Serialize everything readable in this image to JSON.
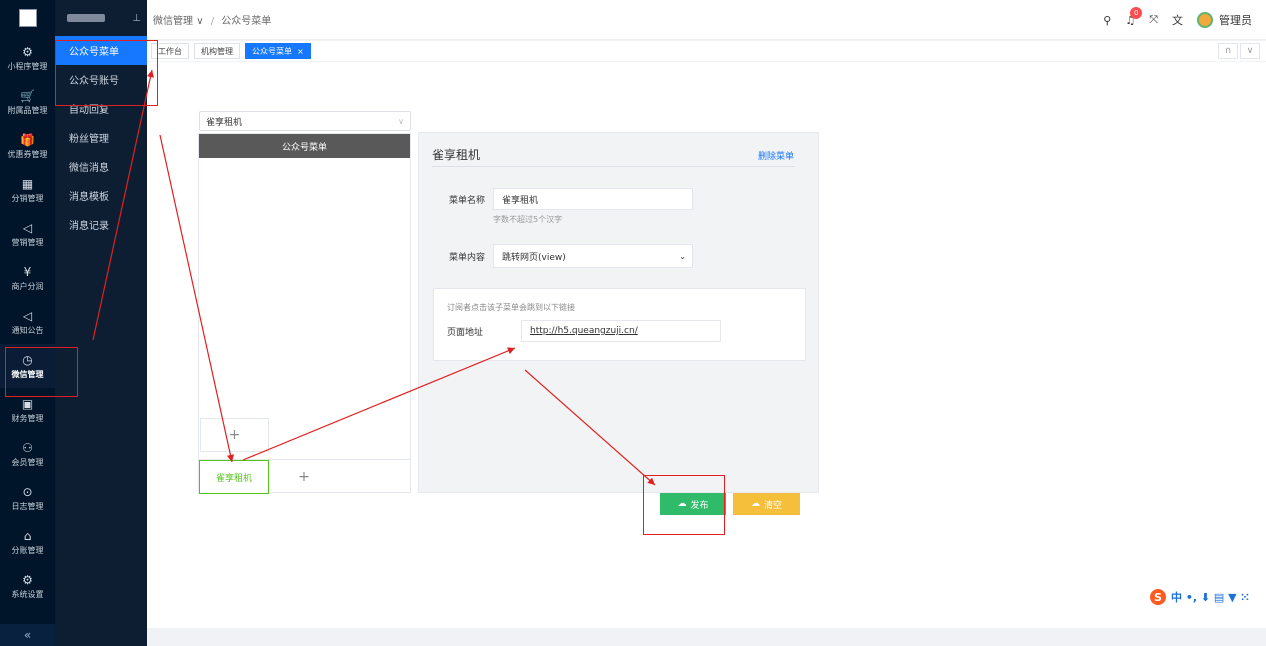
{
  "rail": {
    "items": [
      {
        "label": "小程序管理",
        "icon": "⚙"
      },
      {
        "label": "附属品管理",
        "icon": "🛒"
      },
      {
        "label": "优惠券管理",
        "icon": "🎁"
      },
      {
        "label": "分销管理",
        "icon": "▦"
      },
      {
        "label": "营销管理",
        "icon": "◁"
      },
      {
        "label": "商户分润",
        "icon": "¥"
      },
      {
        "label": "通知公告",
        "icon": "◁"
      },
      {
        "label": "微信管理",
        "icon": "◷"
      },
      {
        "label": "财务管理",
        "icon": "▣"
      },
      {
        "label": "会员管理",
        "icon": "⚇"
      },
      {
        "label": "日志管理",
        "icon": "⊙"
      },
      {
        "label": "分账管理",
        "icon": "⌂"
      },
      {
        "label": "系统设置",
        "icon": "⚙"
      }
    ],
    "collapse_icon": "«"
  },
  "submenu": {
    "pin_icon": "⊥",
    "items": [
      "公众号菜单",
      "公众号账号",
      "自动回复",
      "粉丝管理",
      "微信消息",
      "消息模板",
      "消息记录"
    ]
  },
  "header": {
    "breadcrumb": [
      "微信管理",
      "公众号菜单"
    ],
    "breadcrumb_caret": "∨",
    "breadcrumb_sep": "/",
    "notification_count": "0",
    "user": "管理员",
    "icons": [
      "search-icon",
      "bell-icon",
      "fullscreen-icon",
      "translate-icon"
    ]
  },
  "tabs": {
    "items": [
      "工作台",
      "机构管理",
      "公众号菜单"
    ],
    "close": "×",
    "right_icons": [
      "∩",
      "∨"
    ]
  },
  "account_select": {
    "value": "雀享租机",
    "caret": "∨"
  },
  "phone": {
    "header": "公众号菜单",
    "add_sub": "+",
    "menu_button": "雀享租机",
    "add_menu": "+"
  },
  "editor": {
    "title": "雀享租机",
    "delete": "删除菜单",
    "name_label": "菜单名称",
    "name_value": "雀享租机",
    "name_hint": "字数不超过5个汉字",
    "content_label": "菜单内容",
    "content_value": "跳转网页(view)",
    "content_caret": "⌄",
    "link_hint": "订阅者点击该子菜单会跳到以下链接",
    "url_label": "页面地址",
    "url_value": "http://h5.queangzuji.cn/"
  },
  "actions": {
    "publish": "发布",
    "clear": "清空",
    "icon": "☁"
  },
  "ime": {
    "logo": "S",
    "text": "中 •, ⬇ ▤ ▼ ⁙"
  },
  "colors": {
    "primary": "#1677ff",
    "success": "#2fbb6a",
    "warning": "#f5bf3c",
    "sidebar": "#001529",
    "annotation": "#e02020"
  }
}
